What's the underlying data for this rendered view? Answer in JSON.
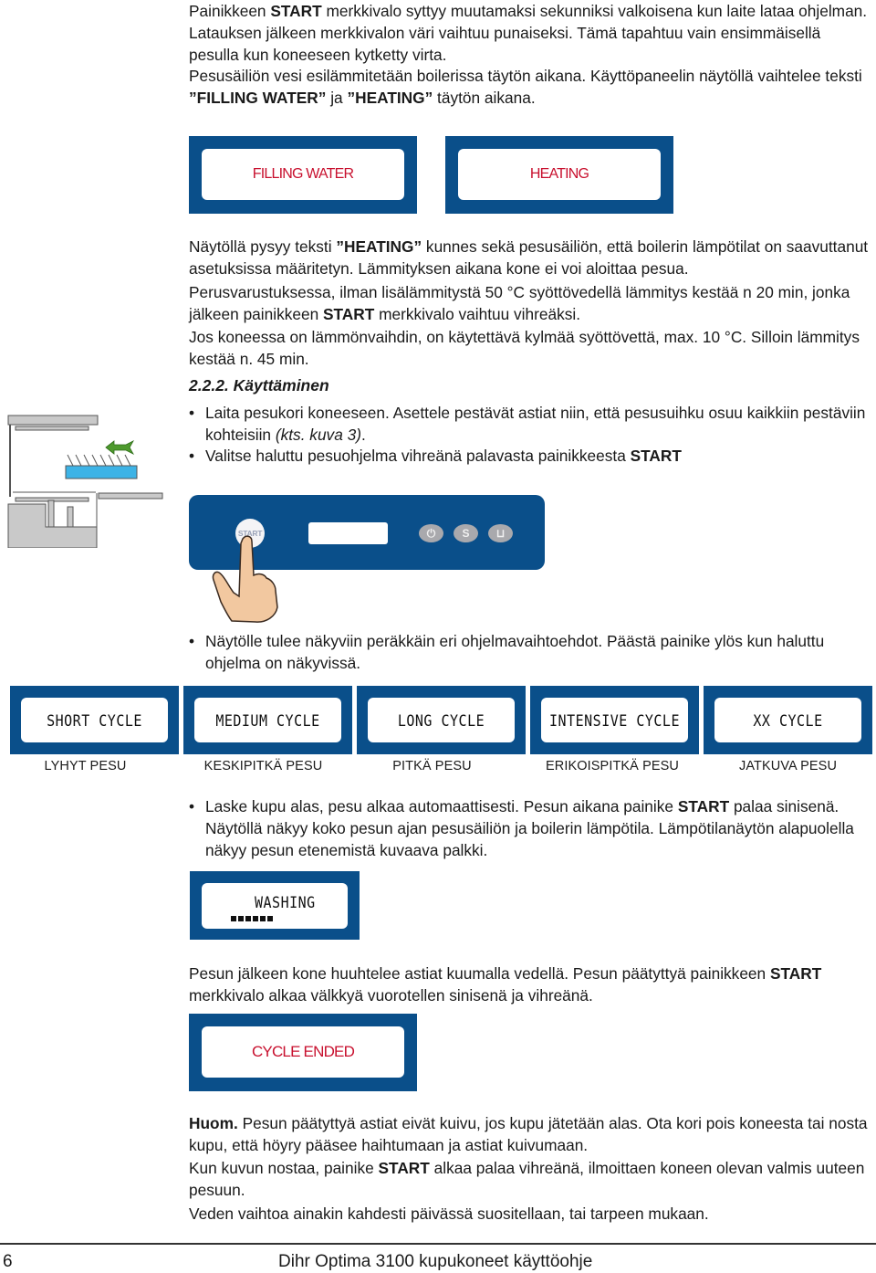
{
  "intro": {
    "p1_pre": "Painikkeen ",
    "p1_bold": "START",
    "p1_post": " merkkivalo syttyy muutamaksi sekunniksi valkoisena kun laite lataa ohjelman. Latauksen jälkeen merkkivalon väri vaihtuu punaiseksi. Tämä tapahtuu vain ensimmäisellä pesulla kun koneeseen kytketty virta.",
    "p2_pre": "Pesusäiliön vesi esilämmitetään boilerissa täytön aikana. Käyttöpaneelin näytöllä vaihtelee teksti ",
    "p2_bold1": "”FILLING WATER”",
    "p2_mid": " ja ",
    "p2_bold2": "”HEATING”",
    "p2_post": " täytön aikana."
  },
  "displays_top": [
    {
      "text": "FILLING WATER"
    },
    {
      "text": "HEATING"
    }
  ],
  "heating": {
    "p1_pre": "Näytöllä pysyy teksti ",
    "p1_bold": "”HEATING”",
    "p1_post": " kunnes sekä pesusäiliön, että boilerin lämpötilat on saavuttanut asetuksissa määritetyn. Lämmityksen aikana kone ei voi aloittaa pesua.",
    "p2_pre": "Perusvarustuksessa, ilman lisälämmitystä 50 °C syöttövedellä lämmitys kestää n 20 min, jonka jälkeen painikkeen ",
    "p2_bold": "START",
    "p2_post": " merkkivalo vaihtuu vihreäksi.",
    "p3": "Jos koneessa on lämmönvaihdin, on käytettävä kylmää syöttövettä, max. 10 °C. Silloin lämmitys kestää n. 45 min."
  },
  "section": {
    "heading": "2.2.2. Käyttäminen",
    "bullet1_pre": "Laita pesukori koneeseen. Asettele pestävät astiat niin, että pesusuihku osuu kaikkiin pestäviin kohteisiin ",
    "bullet1_italic": "(kts. kuva 3)",
    "bullet1_post": ".",
    "bullet2_pre": "Valitse haluttu pesuohjelma vihreänä palavasta painikkeesta ",
    "bullet2_bold": "START",
    "bullet_char": "•"
  },
  "panel": {
    "start_label": "START",
    "buttons": [
      "power-icon",
      "cycle-icon",
      "tank-icon"
    ],
    "colors": {
      "panel": "#0a4f8a",
      "button": "#a9a9ad",
      "display_text_red": "#c8102e"
    }
  },
  "bullet3": "Näytölle tulee näkyviin peräkkäin eri ohjelmavaihtoehdot. Päästä painike ylös kun haluttu ohjelma on näkyvissä.",
  "cycles": [
    {
      "display": "SHORT CYCLE",
      "label": "LYHYT PESU"
    },
    {
      "display": "MEDIUM CYCLE",
      "label": "KESKIPITKÄ PESU"
    },
    {
      "display": "LONG CYCLE",
      "label": "PITKÄ PESU"
    },
    {
      "display": "INTENSIVE CYCLE",
      "label": "ERIKOISPITKÄ PESU"
    },
    {
      "display": "XX CYCLE",
      "label": "JATKUVA PESU"
    }
  ],
  "bullet4_pre": "Laske kupu alas, pesu alkaa automaattisesti. Pesun aikana painike ",
  "bullet4_bold": "START",
  "bullet4_post": " palaa sinisenä. Näytöllä näkyy koko pesun ajan pesusäiliön ja boilerin lämpötila. Lämpötilanäytön alapuolella näkyy pesun etenemistä kuvaava palkki.",
  "washing_display": {
    "text": "WASHING",
    "progress_blocks": 6
  },
  "after": {
    "p1": "Pesun jälkeen kone huuhtelee astiat kuumalla vedellä. Pesun päätyttyä painikkeen ",
    "p2_bold": "START",
    "p2_post": " merkkivalo alkaa välkkyä vuorotellen sinisenä ja vihreänä."
  },
  "ended_display": {
    "text": "CYCLE ENDED"
  },
  "note": {
    "bold": "Huom.",
    "p1": " Pesun päätyttyä astiat eivät kuivu, jos kupu jätetään alas. Ota kori pois koneesta tai nosta kupu, että höyry pääsee haihtumaan ja astiat kuivumaan.",
    "p2_pre": "Kun kuvun nostaa, painike ",
    "p2_bold": "START",
    "p2_post": " alkaa palaa vihreänä, ilmoittaen koneen olevan valmis uuteen pesuun.",
    "p3": "Veden vaihtoa ainakin kahdesti päivässä suositellaan, tai tarpeen mukaan."
  },
  "footer": {
    "page_number": "6",
    "title": "Dihr Optima 3100 kupukoneet käyttöohje"
  }
}
